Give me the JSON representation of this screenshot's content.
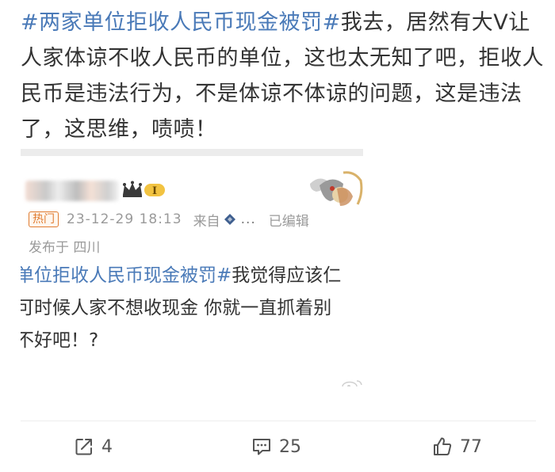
{
  "post": {
    "tag": "#两家单位拒收人民币现金被罚#",
    "text": "我去，居然有大V让人家体谅不收人民币的单位，这也太无知了吧，拒收人民币是违法行为，不是体谅不体谅的问题，这是违法了，这思维，啧啧！"
  },
  "embed": {
    "badge_label": "I",
    "hot_label": "热门",
    "timestamp": "23-12-29 18:13",
    "from_label": "来自",
    "source_dots": "...",
    "edited_label": "已编辑",
    "location": "发布于 四川",
    "body_tag": "单位拒收人民币现金被罚#",
    "body_line1_rest": "我觉得应该仁",
    "body_line2": "可时候人家不想收现金 你就一直抓着别",
    "body_line3": "不好吧！?"
  },
  "actions": {
    "repost_count": "4",
    "comment_count": "25",
    "like_count": "77"
  },
  "icons": {
    "repost": "share-box-arrow-icon",
    "comment": "comment-bubble-icon",
    "like": "thumbs-up-icon",
    "crown": "crown-icon",
    "source": "diamond-source-icon"
  },
  "colors": {
    "tag_blue": "#4a7ab8",
    "text": "#333333",
    "meta_gray": "#9a9a9a",
    "hot_orange": "#e07b30"
  }
}
